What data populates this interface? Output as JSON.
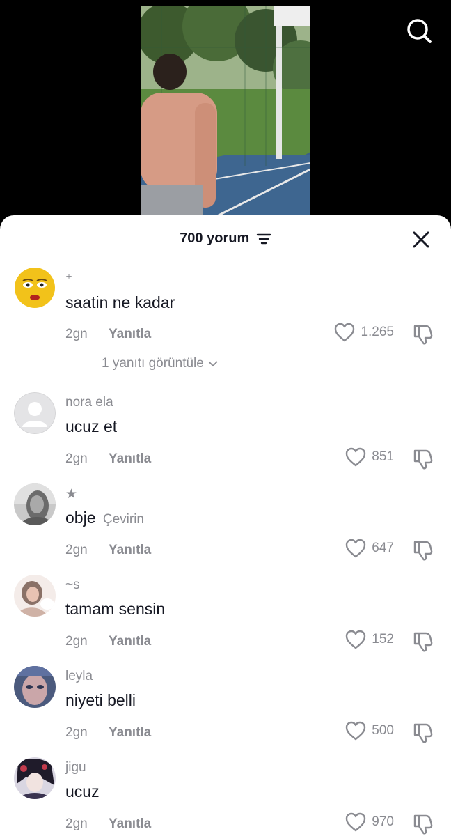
{
  "header": {
    "comment_count": "700 yorum",
    "icons": {
      "search": "search-icon",
      "sort": "sort-icon",
      "close": "close-icon"
    }
  },
  "comments": [
    {
      "username": "⁺",
      "text": "saatin ne kadar",
      "translate": "",
      "time": "2gn",
      "reply_label": "Yanıtla",
      "likes": "1.265",
      "view_replies": "1 yanıtı görüntüle"
    },
    {
      "username": "nora ela",
      "text": "ucuz et",
      "translate": "",
      "time": "2gn",
      "reply_label": "Yanıtla",
      "likes": "851"
    },
    {
      "username": "★",
      "text": "obje",
      "translate": "Çevirin",
      "time": "2gn",
      "reply_label": "Yanıtla",
      "likes": "647"
    },
    {
      "username": "~s",
      "text": "tamam sensin",
      "translate": "",
      "time": "2gn",
      "reply_label": "Yanıtla",
      "likes": "152"
    },
    {
      "username": "leyla",
      "text": "niyeti belli",
      "translate": "",
      "time": "2gn",
      "reply_label": "Yanıtla",
      "likes": "500"
    },
    {
      "username": "jigu",
      "text": "ucuz",
      "translate": "",
      "time": "2gn",
      "reply_label": "Yanıtla",
      "likes": "970"
    }
  ],
  "colors": {
    "primary_text": "#161823",
    "secondary_text": "#8a8b91",
    "sheet_bg": "#ffffff",
    "backdrop": "#000000"
  }
}
